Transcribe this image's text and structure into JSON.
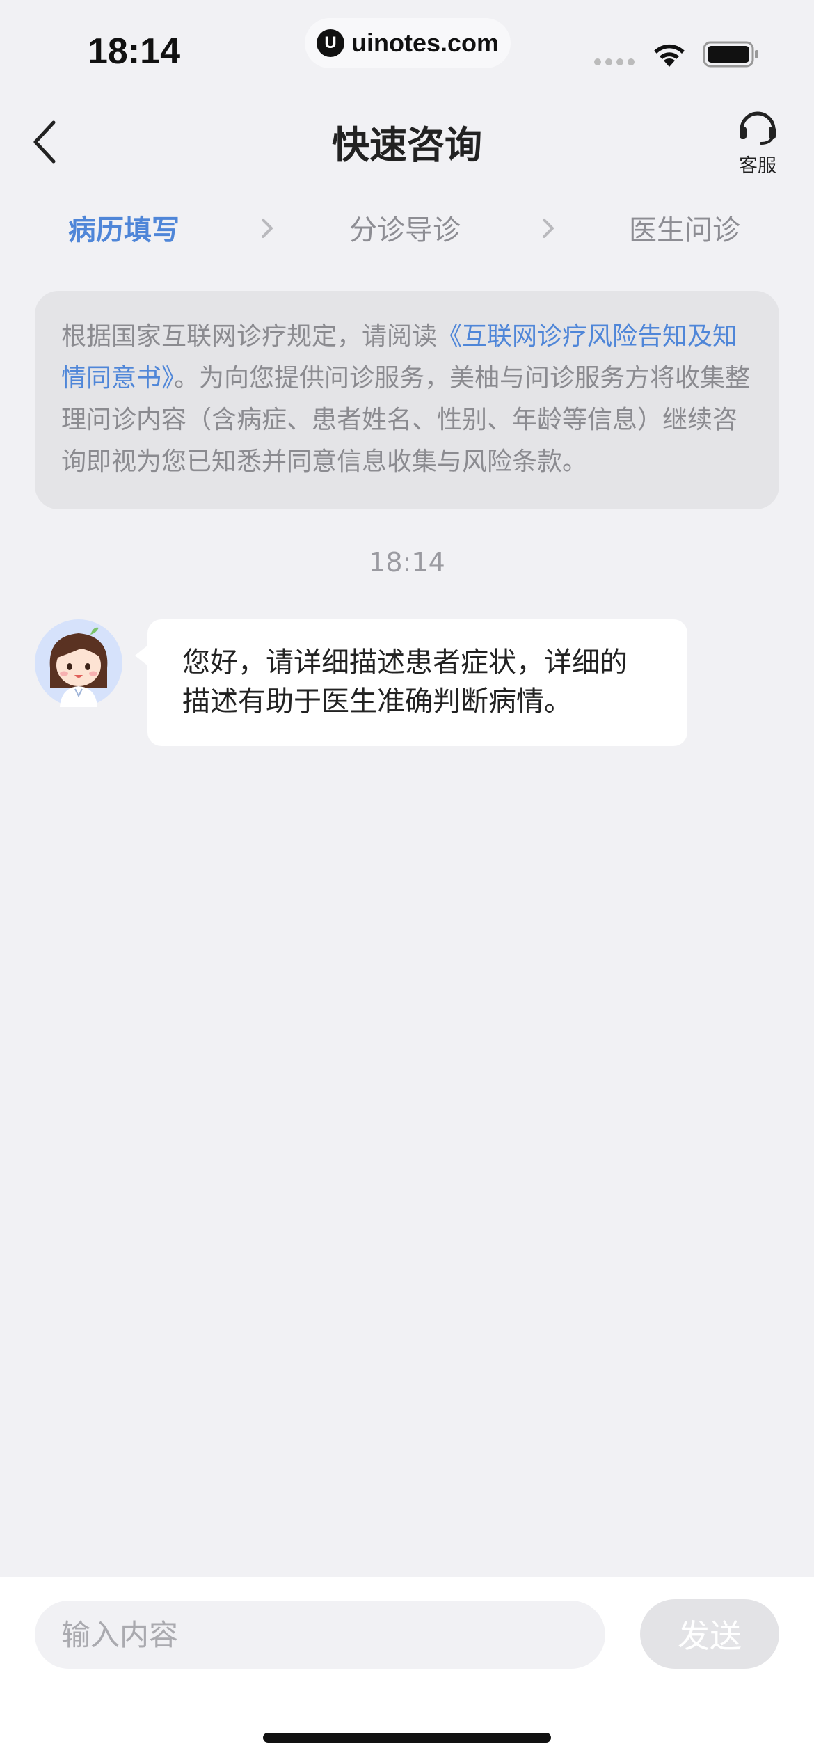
{
  "status_bar": {
    "time": "18:14",
    "url": "uinotes.com",
    "url_logo": "U"
  },
  "nav": {
    "title": "快速咨询",
    "service_label": "客服"
  },
  "steps": [
    {
      "label": "病历填写",
      "active": true
    },
    {
      "label": "分诊导诊",
      "active": false
    },
    {
      "label": "医生问诊",
      "active": false
    }
  ],
  "notice": {
    "prefix": "根据国家互联网诊疗规定，请阅读",
    "link": "《互联网诊疗风险告知及知情同意书》",
    "suffix": "。为向您提供问诊服务，美柚与问诊服务方将收集整理问诊内容（含病症、患者姓名、性别、年龄等信息）继续咨询即视为您已知悉并同意信息收集与风险条款。"
  },
  "chat": {
    "timestamp": "18:14",
    "messages": [
      {
        "sender": "assistant",
        "text": "您好，请详细描述患者症状，详细的描述有助于医生准确判断病情。"
      }
    ]
  },
  "input": {
    "placeholder": "输入内容",
    "value": "",
    "send_label": "发送"
  },
  "colors": {
    "accent": "#4f86d8",
    "background": "#f1f1f4",
    "notice_bg": "#e4e4e7"
  }
}
